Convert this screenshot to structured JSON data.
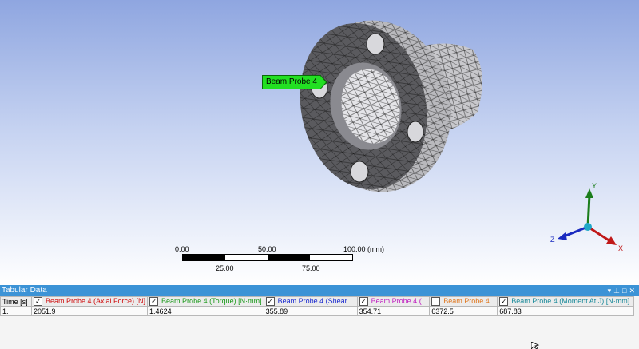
{
  "viewport": {
    "probe_label": "Beam Probe 4",
    "scale": {
      "top_labels": [
        "0.00",
        "50.00",
        "100.00 (mm)"
      ],
      "bottom_labels": [
        "25.00",
        "75.00"
      ]
    },
    "triad": {
      "x": "X",
      "y": "Y",
      "z": "Z"
    }
  },
  "tabular": {
    "title": "Tabular Data",
    "columns": [
      {
        "label": "Time [s]",
        "checked": null,
        "color": "#000000"
      },
      {
        "label": "Beam Probe 4 (Axial Force) [N]",
        "checked": true,
        "color": "#d01010"
      },
      {
        "label": "Beam Probe 4 (Torque) [N·mm]",
        "checked": true,
        "color": "#1c9a1c"
      },
      {
        "label": "Beam Probe 4 (Shear ...",
        "checked": true,
        "color": "#1a2ad0"
      },
      {
        "label": "Beam Probe 4 (...",
        "checked": true,
        "color": "#c020c0"
      },
      {
        "label": "Beam Probe 4...",
        "checked": false,
        "color": "#e07820"
      },
      {
        "label": "Beam Probe 4 (Moment At J) [N·mm]",
        "checked": true,
        "color": "#1a8a9a"
      }
    ],
    "rows": [
      [
        "1.",
        "2051.9",
        "1.4624",
        "355.89",
        "354.71",
        "6372.5",
        "687.83"
      ]
    ]
  }
}
